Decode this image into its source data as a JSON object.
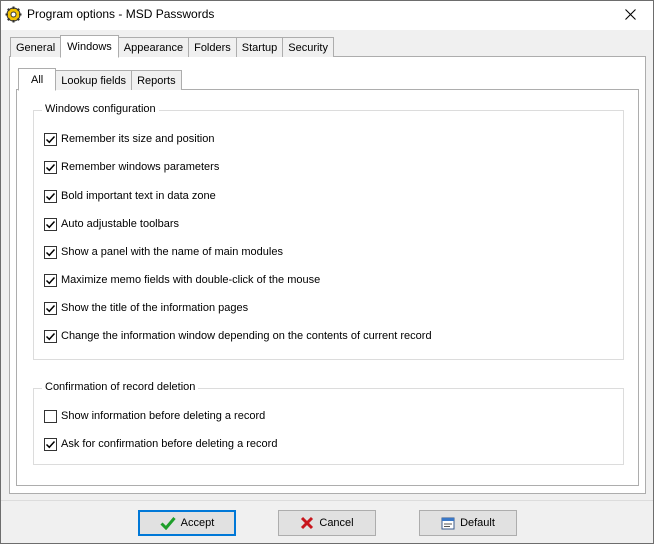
{
  "window": {
    "title": "Program options - MSD Passwords",
    "close_glyph": "✕"
  },
  "outer_tabs": [
    {
      "label": "General",
      "active": false
    },
    {
      "label": "Windows",
      "active": true
    },
    {
      "label": "Appearance",
      "active": false
    },
    {
      "label": "Folders",
      "active": false
    },
    {
      "label": "Startup",
      "active": false
    },
    {
      "label": "Security",
      "active": false
    }
  ],
  "inner_tabs": [
    {
      "label": "All",
      "active": true
    },
    {
      "label": "Lookup fields",
      "active": false
    },
    {
      "label": "Reports",
      "active": false
    }
  ],
  "windows_config": {
    "title": "Windows configuration",
    "items": [
      {
        "label": "Remember its size and position",
        "checked": true
      },
      {
        "label": "Remember windows parameters",
        "checked": true
      },
      {
        "label": "Bold important text in data zone",
        "checked": true
      },
      {
        "label": "Auto adjustable toolbars",
        "checked": true
      },
      {
        "label": "Show a panel with the name of main modules",
        "checked": true
      },
      {
        "label": "Maximize memo fields with double-click of the mouse",
        "checked": true
      },
      {
        "label": "Show the title of the information pages",
        "checked": true
      },
      {
        "label": "Change the information window depending on the contents of current record",
        "checked": true
      }
    ]
  },
  "deletion": {
    "title": "Confirmation of record deletion",
    "items": [
      {
        "label": "Show information before deleting a record",
        "checked": false
      },
      {
        "label": "Ask for confirmation before deleting a record",
        "checked": true
      }
    ]
  },
  "buttons": {
    "accept": "Accept",
    "cancel": "Cancel",
    "default": "Default"
  },
  "colors": {
    "accept_check": "#1e9e2a",
    "cancel_x": "#c8161d",
    "focus_border": "#0078d7"
  }
}
